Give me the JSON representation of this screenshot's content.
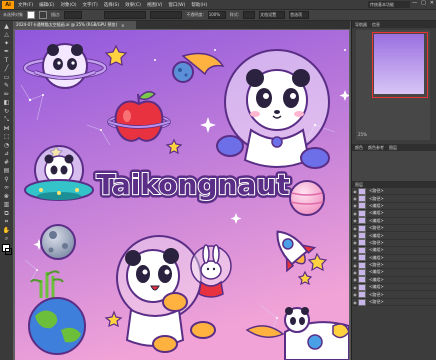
{
  "app": {
    "logo": "Ai",
    "menus": [
      "文件(F)",
      "编辑(E)",
      "对象(O)",
      "文字(T)",
      "选择(S)",
      "效果(C)",
      "视图(V)",
      "窗口(W)",
      "帮助(H)"
    ],
    "workspace": "传统基本功能",
    "win_min": "—",
    "win_max": "□",
    "win_close": "✕"
  },
  "control": {
    "selection_label": "未选择对象",
    "stroke_label": "描边:",
    "opacity_label": "不透明度:",
    "opacity_value": "100%",
    "style_label": "样式:",
    "doc_setup": "文档设置",
    "prefs": "首选项"
  },
  "document": {
    "tab_title": "2024-07卡通熊猫太空插画.ai @ 25% (RGB/GPU 预览)",
    "tab_close": "×"
  },
  "artwork": {
    "title": "Taikongnaut",
    "bg_top": "#8f57dc",
    "bg_bottom": "#f1a3d7"
  },
  "navigator": {
    "tabs": [
      "导航器",
      "信息"
    ],
    "zoom": "25%"
  },
  "layers": {
    "tabs": [
      "颜色",
      "颜色参考",
      "图层"
    ],
    "header": "图层",
    "items": [
      "<路径>",
      "<路径>",
      "<编组>",
      "<编组>",
      "<编组>",
      "<路径>",
      "<编组>",
      "<路径>",
      "<编组>",
      "<编组>",
      "<路径>",
      "<编组>",
      "<编组>",
      "<编组>",
      "<路径>",
      "<路径>"
    ]
  }
}
